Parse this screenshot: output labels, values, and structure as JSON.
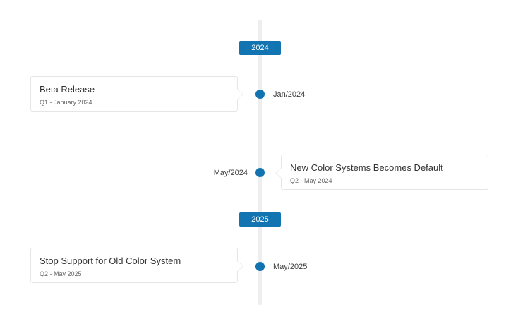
{
  "years": [
    "2024",
    "2025"
  ],
  "events": [
    {
      "title": "Beta Release",
      "subtitle": "Q1 - January 2024",
      "date": "Jan/2024",
      "side": "left"
    },
    {
      "title": "New Color Systems Becomes Default",
      "subtitle": "Q2 - May 2024",
      "date": "May/2024",
      "side": "right"
    },
    {
      "title": "Stop Support for Old Color System",
      "subtitle": "Q2 - May 2025",
      "date": "May/2025",
      "side": "left"
    }
  ],
  "colors": {
    "accent": "#1274b0",
    "line": "#eeeeee",
    "card_border": "#e6e6e6"
  }
}
